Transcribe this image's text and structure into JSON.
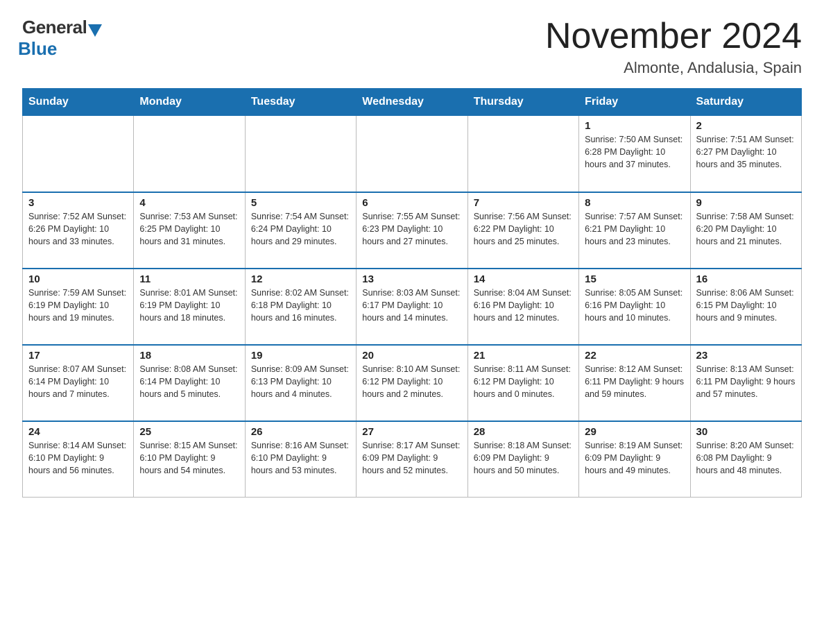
{
  "header": {
    "logo_general": "General",
    "logo_blue": "Blue",
    "month_title": "November 2024",
    "location": "Almonte, Andalusia, Spain"
  },
  "weekdays": [
    "Sunday",
    "Monday",
    "Tuesday",
    "Wednesday",
    "Thursday",
    "Friday",
    "Saturday"
  ],
  "weeks": [
    [
      {
        "day": "",
        "info": ""
      },
      {
        "day": "",
        "info": ""
      },
      {
        "day": "",
        "info": ""
      },
      {
        "day": "",
        "info": ""
      },
      {
        "day": "",
        "info": ""
      },
      {
        "day": "1",
        "info": "Sunrise: 7:50 AM\nSunset: 6:28 PM\nDaylight: 10 hours and 37 minutes."
      },
      {
        "day": "2",
        "info": "Sunrise: 7:51 AM\nSunset: 6:27 PM\nDaylight: 10 hours and 35 minutes."
      }
    ],
    [
      {
        "day": "3",
        "info": "Sunrise: 7:52 AM\nSunset: 6:26 PM\nDaylight: 10 hours and 33 minutes."
      },
      {
        "day": "4",
        "info": "Sunrise: 7:53 AM\nSunset: 6:25 PM\nDaylight: 10 hours and 31 minutes."
      },
      {
        "day": "5",
        "info": "Sunrise: 7:54 AM\nSunset: 6:24 PM\nDaylight: 10 hours and 29 minutes."
      },
      {
        "day": "6",
        "info": "Sunrise: 7:55 AM\nSunset: 6:23 PM\nDaylight: 10 hours and 27 minutes."
      },
      {
        "day": "7",
        "info": "Sunrise: 7:56 AM\nSunset: 6:22 PM\nDaylight: 10 hours and 25 minutes."
      },
      {
        "day": "8",
        "info": "Sunrise: 7:57 AM\nSunset: 6:21 PM\nDaylight: 10 hours and 23 minutes."
      },
      {
        "day": "9",
        "info": "Sunrise: 7:58 AM\nSunset: 6:20 PM\nDaylight: 10 hours and 21 minutes."
      }
    ],
    [
      {
        "day": "10",
        "info": "Sunrise: 7:59 AM\nSunset: 6:19 PM\nDaylight: 10 hours and 19 minutes."
      },
      {
        "day": "11",
        "info": "Sunrise: 8:01 AM\nSunset: 6:19 PM\nDaylight: 10 hours and 18 minutes."
      },
      {
        "day": "12",
        "info": "Sunrise: 8:02 AM\nSunset: 6:18 PM\nDaylight: 10 hours and 16 minutes."
      },
      {
        "day": "13",
        "info": "Sunrise: 8:03 AM\nSunset: 6:17 PM\nDaylight: 10 hours and 14 minutes."
      },
      {
        "day": "14",
        "info": "Sunrise: 8:04 AM\nSunset: 6:16 PM\nDaylight: 10 hours and 12 minutes."
      },
      {
        "day": "15",
        "info": "Sunrise: 8:05 AM\nSunset: 6:16 PM\nDaylight: 10 hours and 10 minutes."
      },
      {
        "day": "16",
        "info": "Sunrise: 8:06 AM\nSunset: 6:15 PM\nDaylight: 10 hours and 9 minutes."
      }
    ],
    [
      {
        "day": "17",
        "info": "Sunrise: 8:07 AM\nSunset: 6:14 PM\nDaylight: 10 hours and 7 minutes."
      },
      {
        "day": "18",
        "info": "Sunrise: 8:08 AM\nSunset: 6:14 PM\nDaylight: 10 hours and 5 minutes."
      },
      {
        "day": "19",
        "info": "Sunrise: 8:09 AM\nSunset: 6:13 PM\nDaylight: 10 hours and 4 minutes."
      },
      {
        "day": "20",
        "info": "Sunrise: 8:10 AM\nSunset: 6:12 PM\nDaylight: 10 hours and 2 minutes."
      },
      {
        "day": "21",
        "info": "Sunrise: 8:11 AM\nSunset: 6:12 PM\nDaylight: 10 hours and 0 minutes."
      },
      {
        "day": "22",
        "info": "Sunrise: 8:12 AM\nSunset: 6:11 PM\nDaylight: 9 hours and 59 minutes."
      },
      {
        "day": "23",
        "info": "Sunrise: 8:13 AM\nSunset: 6:11 PM\nDaylight: 9 hours and 57 minutes."
      }
    ],
    [
      {
        "day": "24",
        "info": "Sunrise: 8:14 AM\nSunset: 6:10 PM\nDaylight: 9 hours and 56 minutes."
      },
      {
        "day": "25",
        "info": "Sunrise: 8:15 AM\nSunset: 6:10 PM\nDaylight: 9 hours and 54 minutes."
      },
      {
        "day": "26",
        "info": "Sunrise: 8:16 AM\nSunset: 6:10 PM\nDaylight: 9 hours and 53 minutes."
      },
      {
        "day": "27",
        "info": "Sunrise: 8:17 AM\nSunset: 6:09 PM\nDaylight: 9 hours and 52 minutes."
      },
      {
        "day": "28",
        "info": "Sunrise: 8:18 AM\nSunset: 6:09 PM\nDaylight: 9 hours and 50 minutes."
      },
      {
        "day": "29",
        "info": "Sunrise: 8:19 AM\nSunset: 6:09 PM\nDaylight: 9 hours and 49 minutes."
      },
      {
        "day": "30",
        "info": "Sunrise: 8:20 AM\nSunset: 6:08 PM\nDaylight: 9 hours and 48 minutes."
      }
    ]
  ]
}
